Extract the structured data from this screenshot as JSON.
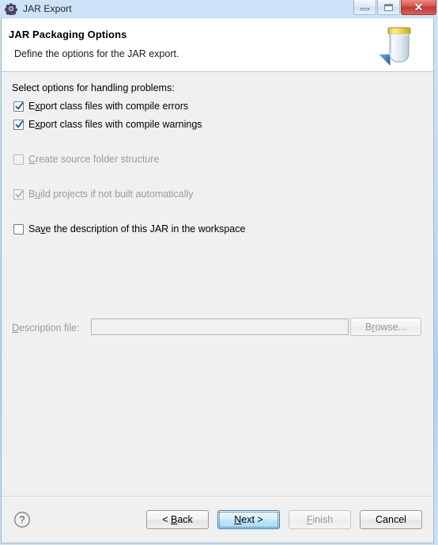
{
  "window": {
    "title": "JAR Export",
    "title_icon": "jar-export-cog-icon",
    "controls": {
      "minimize": "minimize-icon",
      "maximize": "restore-icon",
      "close": "close-icon",
      "close_glyph": "✕"
    }
  },
  "header": {
    "title": "JAR Packaging Options",
    "description": "Define the options for the JAR export.",
    "banner_icon": "jar-banner-icon"
  },
  "body": {
    "section_label": "Select options for handling problems:",
    "options": [
      {
        "label_before": "E",
        "label_mnemonic": "x",
        "label_after": "port class files with compile errors",
        "checked": true,
        "enabled": true,
        "name": "export-class-files-compile-errors"
      },
      {
        "label_before": "E",
        "label_mnemonic": "x",
        "label_after": "port class files with compile warnings",
        "checked": true,
        "enabled": true,
        "name": "export-class-files-compile-warnings"
      },
      {
        "label_before": "",
        "label_mnemonic": "C",
        "label_after": "reate source folder structure",
        "checked": false,
        "enabled": false,
        "name": "create-source-folder-structure"
      },
      {
        "label_before": "B",
        "label_mnemonic": "u",
        "label_after": "ild projects if not built automatically",
        "checked": true,
        "enabled": false,
        "name": "build-projects-if-not-built-automatically"
      },
      {
        "label_before": "Sa",
        "label_mnemonic": "v",
        "label_after": "e the description of this JAR in the workspace",
        "checked": false,
        "enabled": true,
        "name": "save-description-of-jar-in-workspace"
      }
    ],
    "description_file": {
      "label_before": "",
      "label_mnemonic": "D",
      "label_after": "escription file:",
      "value": "",
      "placeholder": "",
      "enabled": false
    },
    "browse_button": {
      "label_before": "B",
      "label_mnemonic": "r",
      "label_after": "owse...",
      "enabled": false
    }
  },
  "footer": {
    "help_icon": "help-icon",
    "buttons": [
      {
        "name": "back-button",
        "label_before": "< ",
        "label_mnemonic": "B",
        "label_after": "ack",
        "enabled": true,
        "focused": false
      },
      {
        "name": "next-button",
        "label_before": "",
        "label_mnemonic": "N",
        "label_after": "ext >",
        "enabled": true,
        "focused": true
      },
      {
        "name": "finish-button",
        "label_before": "",
        "label_mnemonic": "F",
        "label_after": "inish",
        "enabled": false,
        "focused": false
      },
      {
        "name": "cancel-button",
        "label_before": "Cancel",
        "label_mnemonic": "",
        "label_after": "",
        "enabled": true,
        "focused": false
      }
    ]
  },
  "colors": {
    "titlebar_accent": "#bcd9f4",
    "close_button": "#c0392b",
    "focus_border": "#3c7fb1",
    "jar_lid": "#e8d44a",
    "arrow_blue": "#2f6fb5"
  }
}
